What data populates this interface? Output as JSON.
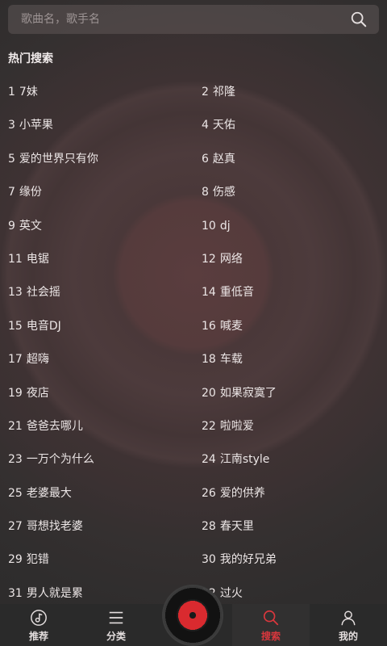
{
  "search": {
    "placeholder": "歌曲名，歌手名"
  },
  "hot_search": {
    "title": "热门搜索",
    "items": [
      {
        "num": "1",
        "text": "7妹"
      },
      {
        "num": "2",
        "text": "祁隆"
      },
      {
        "num": "3",
        "text": "小苹果"
      },
      {
        "num": "4",
        "text": "天佑"
      },
      {
        "num": "5",
        "text": "爱的世界只有你"
      },
      {
        "num": "6",
        "text": "赵真"
      },
      {
        "num": "7",
        "text": "缘份"
      },
      {
        "num": "8",
        "text": "伤感"
      },
      {
        "num": "9",
        "text": "英文"
      },
      {
        "num": "10",
        "text": "dj"
      },
      {
        "num": "11",
        "text": "电锯"
      },
      {
        "num": "12",
        "text": "网络"
      },
      {
        "num": "13",
        "text": "社会摇"
      },
      {
        "num": "14",
        "text": "重低音"
      },
      {
        "num": "15",
        "text": "电音DJ"
      },
      {
        "num": "16",
        "text": "喊麦"
      },
      {
        "num": "17",
        "text": "超嗨"
      },
      {
        "num": "18",
        "text": "车载"
      },
      {
        "num": "19",
        "text": "夜店"
      },
      {
        "num": "20",
        "text": "如果寂寞了"
      },
      {
        "num": "21",
        "text": "爸爸去哪儿"
      },
      {
        "num": "22",
        "text": "啦啦爱"
      },
      {
        "num": "23",
        "text": "一万个为什么"
      },
      {
        "num": "24",
        "text": "江南style"
      },
      {
        "num": "25",
        "text": "老婆最大"
      },
      {
        "num": "26",
        "text": "爱的供养"
      },
      {
        "num": "27",
        "text": "哥想找老婆"
      },
      {
        "num": "28",
        "text": "春天里"
      },
      {
        "num": "29",
        "text": "犯错"
      },
      {
        "num": "30",
        "text": "我的好兄弟"
      },
      {
        "num": "31",
        "text": "男人就是累"
      },
      {
        "num": "32",
        "text": "过火"
      }
    ]
  },
  "nav": {
    "recommend": "推荐",
    "category": "分类",
    "search": "搜索",
    "mine": "我的",
    "active_color": "#d9373d"
  }
}
